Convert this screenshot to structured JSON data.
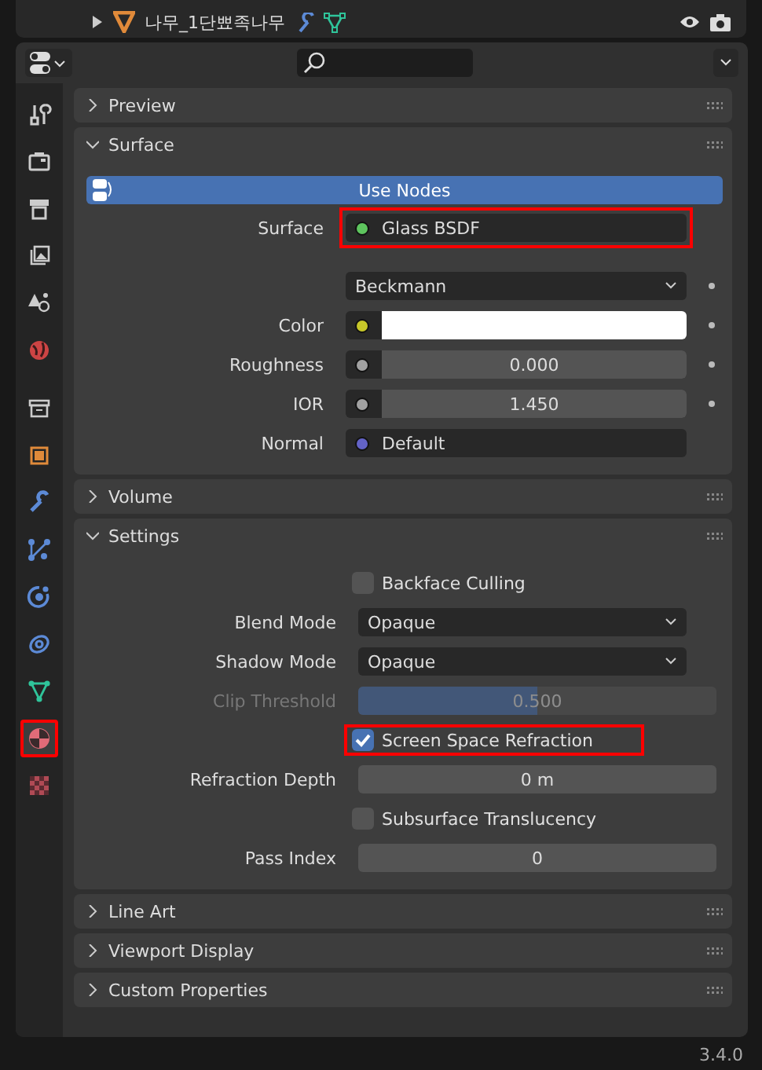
{
  "outliner": {
    "rows": [
      {
        "name": "나무_1단뾰족나무",
        "expanded": false
      }
    ]
  },
  "tabs": [
    {
      "kind": "tool",
      "selected": false,
      "highlighted": false
    },
    {
      "kind": "render",
      "selected": false,
      "highlighted": false
    },
    {
      "kind": "output",
      "selected": false,
      "highlighted": false
    },
    {
      "kind": "view_layer",
      "selected": false,
      "highlighted": false
    },
    {
      "kind": "scene",
      "selected": false,
      "highlighted": false
    },
    {
      "kind": "world",
      "selected": false,
      "highlighted": false
    },
    {
      "kind": "collection",
      "selected": false,
      "highlighted": false
    },
    {
      "kind": "object",
      "selected": false,
      "highlighted": false
    },
    {
      "kind": "modifier",
      "selected": false,
      "highlighted": false
    },
    {
      "kind": "particles",
      "selected": false,
      "highlighted": false
    },
    {
      "kind": "physics",
      "selected": false,
      "highlighted": false
    },
    {
      "kind": "constraint",
      "selected": false,
      "highlighted": false
    },
    {
      "kind": "data",
      "selected": false,
      "highlighted": false
    },
    {
      "kind": "material",
      "selected": true,
      "highlighted": true
    },
    {
      "kind": "texture",
      "selected": false,
      "highlighted": false
    }
  ],
  "panels": [
    {
      "title": "Preview",
      "expanded": false
    },
    {
      "title": "Surface",
      "expanded": true,
      "use_nodes": "Use Nodes",
      "rows": [
        {
          "kind": "socket",
          "label": "Surface",
          "color": "#5ec45e",
          "value": "Glass BSDF",
          "highlighted": true,
          "keyframe": false
        },
        {
          "kind": "dropdown",
          "value": "Beckmann",
          "keyframe": true
        },
        {
          "kind": "color",
          "label": "Color",
          "color": "#c7c729",
          "keyframe": true
        },
        {
          "kind": "number",
          "label": "Roughness",
          "color": "#a1a1a1",
          "value": "0.000",
          "keyframe": true
        },
        {
          "kind": "number",
          "label": "IOR",
          "color": "#a1a1a1",
          "value": "1.450",
          "keyframe": true
        },
        {
          "kind": "socket",
          "label": "Normal",
          "color": "#6363c7",
          "value": "Default",
          "highlighted": false,
          "keyframe": false
        }
      ]
    },
    {
      "title": "Volume",
      "expanded": false
    },
    {
      "title": "Settings",
      "expanded": true,
      "rows": [
        {
          "kind": "checkbox",
          "label": "Backface Culling",
          "checked": false,
          "highlighted": false
        },
        {
          "kind": "dropdown",
          "label": "Blend Mode",
          "value": "Opaque",
          "keyframe": false
        },
        {
          "kind": "dropdown",
          "label": "Shadow Mode",
          "value": "Opaque",
          "keyframe": false
        },
        {
          "kind": "slider",
          "label": "Clip Threshold",
          "value": "0.500",
          "level": 0.5,
          "disabled": true
        },
        {
          "kind": "checkbox",
          "label": "Screen Space Refraction",
          "checked": true,
          "highlighted": true
        },
        {
          "kind": "field",
          "label": "Refraction Depth",
          "value": "0 m"
        },
        {
          "kind": "checkbox",
          "label": "Subsurface Translucency",
          "checked": false,
          "highlighted": false
        },
        {
          "kind": "field",
          "label": "Pass Index",
          "value": "0"
        }
      ]
    },
    {
      "title": "Line Art",
      "expanded": false
    },
    {
      "title": "Viewport Display",
      "expanded": false
    },
    {
      "title": "Custom Properties",
      "expanded": false
    }
  ],
  "status_bar": {
    "version": "3.4.0"
  }
}
